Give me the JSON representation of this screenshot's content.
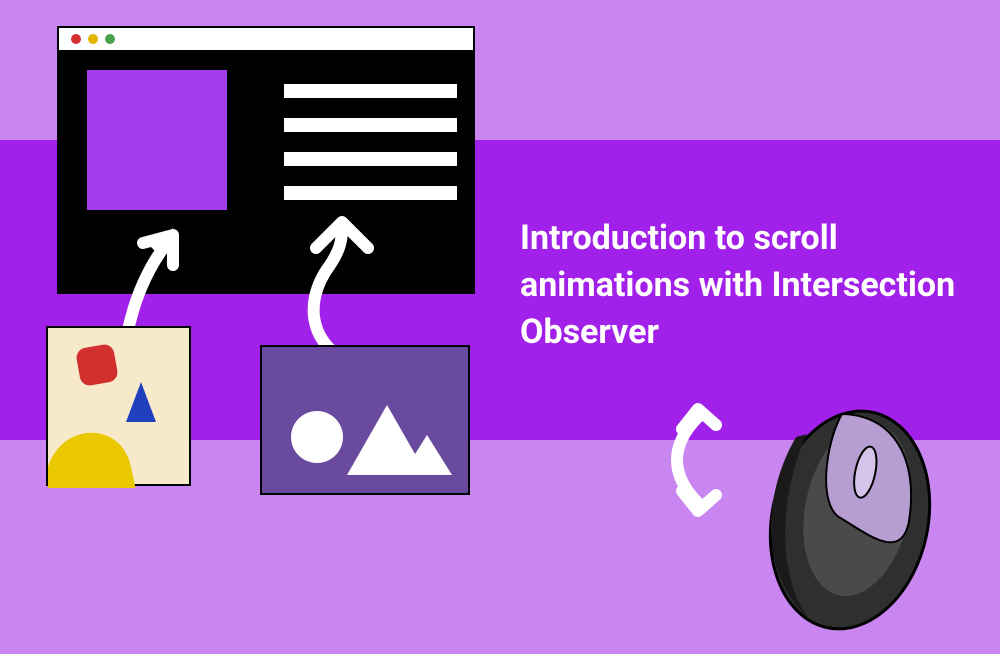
{
  "title": "Introduction to scroll animations with Intersection Observer",
  "colors": {
    "bg_light": "#c986f0",
    "bg_band": "#a221ea",
    "text": "#ffffff",
    "browser_body": "#000000",
    "placeholder_fill": "#a33deb",
    "cardA_bg": "#f7eacb",
    "cardB_bg": "#6a4a9e",
    "mouse_body": "#333333",
    "mouse_accent": "#b79ed2",
    "dot_red": "#d22f2f",
    "dot_yellow": "#e3b600",
    "dot_green": "#4ba24b"
  },
  "browser": {
    "dots": [
      "red",
      "yellow",
      "green"
    ],
    "line_count": 4
  },
  "cardA_shapes": [
    "red-rounded-square",
    "blue-triangle",
    "yellow-blob"
  ],
  "cardB_shapes": [
    "white-circle",
    "white-triangle-large",
    "white-triangle-small"
  ],
  "illustration_elements": [
    "browser-window-placeholder-image",
    "browser-window-placeholder-text-lines",
    "card-with-primary-shapes",
    "card-with-monochrome-shapes",
    "arrow-to-image",
    "curved-arrow-to-text",
    "scroll-direction-arrow",
    "computer-mouse"
  ]
}
